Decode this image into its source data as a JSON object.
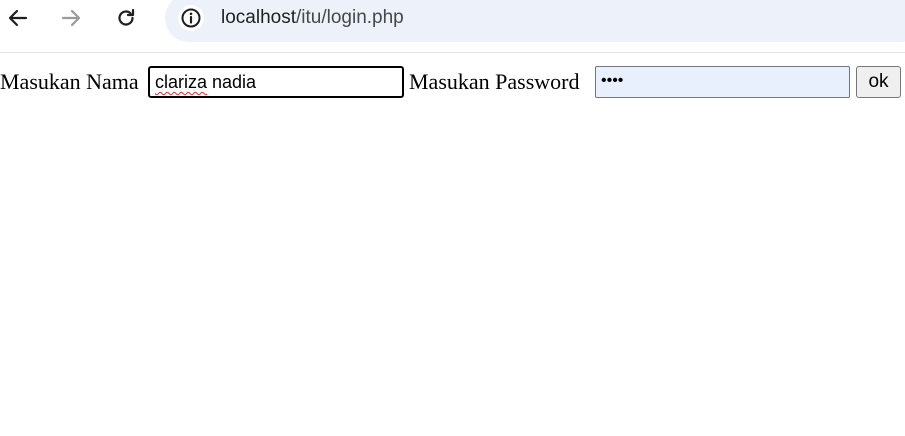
{
  "browser": {
    "url_host": "localhost",
    "url_path": "/itu/login.php",
    "icons": {
      "back": "back-arrow-icon",
      "forward": "forward-arrow-icon",
      "reload": "reload-icon",
      "site_info": "info-icon"
    }
  },
  "form": {
    "name_label": "Masukan Nama",
    "name_value_first": "clariza",
    "name_value_rest": " nadia",
    "password_label": "Masukan Password",
    "password_value_masked": "••••",
    "submit_label": "ok"
  },
  "colors": {
    "address_bar_bg": "#edf2fa",
    "autofill_bg": "#e8f0fe",
    "spellcheck_underline": "#d93025"
  }
}
